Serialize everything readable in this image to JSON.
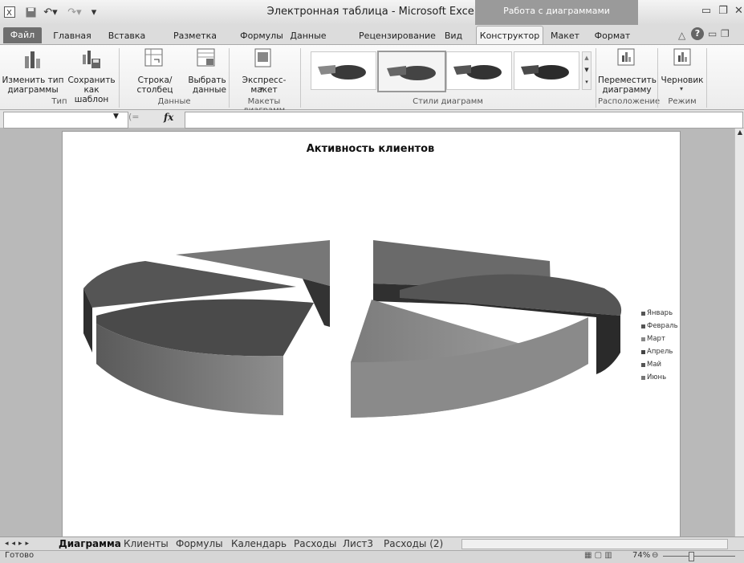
{
  "title": {
    "app": "Электронная таблица  -  Microsoft Excel",
    "context_group": "Работа с диаграммами"
  },
  "tabs": [
    "Файл",
    "Главная",
    "Вставка",
    "Разметка страницы",
    "Формулы",
    "Данные",
    "Рецензирование",
    "Вид",
    "Конструктор",
    "Макет",
    "Формат"
  ],
  "ribbon": {
    "type_group": {
      "change_type": [
        "Изменить тип",
        "диаграммы"
      ],
      "save_template": [
        "Сохранить",
        "как шаблон"
      ],
      "label": "Тип"
    },
    "data_group": {
      "switch": "Строка/столбец",
      "select": [
        "Выбрать",
        "данные"
      ],
      "label": "Данные"
    },
    "layouts_group": {
      "express": "Экспресс-макет",
      "label": "Макеты диаграмм"
    },
    "styles_group": {
      "label": "Стили диаграмм"
    },
    "location_group": {
      "move": [
        "Переместить",
        "диаграмму"
      ],
      "label": "Расположение"
    },
    "mode_group": {
      "draft": "Черновик",
      "label": "Режим"
    }
  },
  "formula_bar": {
    "fx": "fx"
  },
  "chart_data": {
    "type": "pie",
    "title": "Активность клиентов",
    "categories": [
      "Январь",
      "Февраль",
      "Март",
      "Апрель",
      "Май",
      "Июнь"
    ],
    "legend": "right",
    "style": "3d-exploded"
  },
  "sheet_tabs": [
    "Диаграмма",
    "Клиенты",
    "Формулы",
    "Календарь",
    "Расходы",
    "Лист3",
    "Расходы (2)"
  ],
  "status": {
    "ready": "Готово",
    "zoom": "74%"
  },
  "colors": {
    "ribbon": "#f2f2f2",
    "context": "#9a9a9a",
    "file_tab": "#6e6e6e"
  }
}
